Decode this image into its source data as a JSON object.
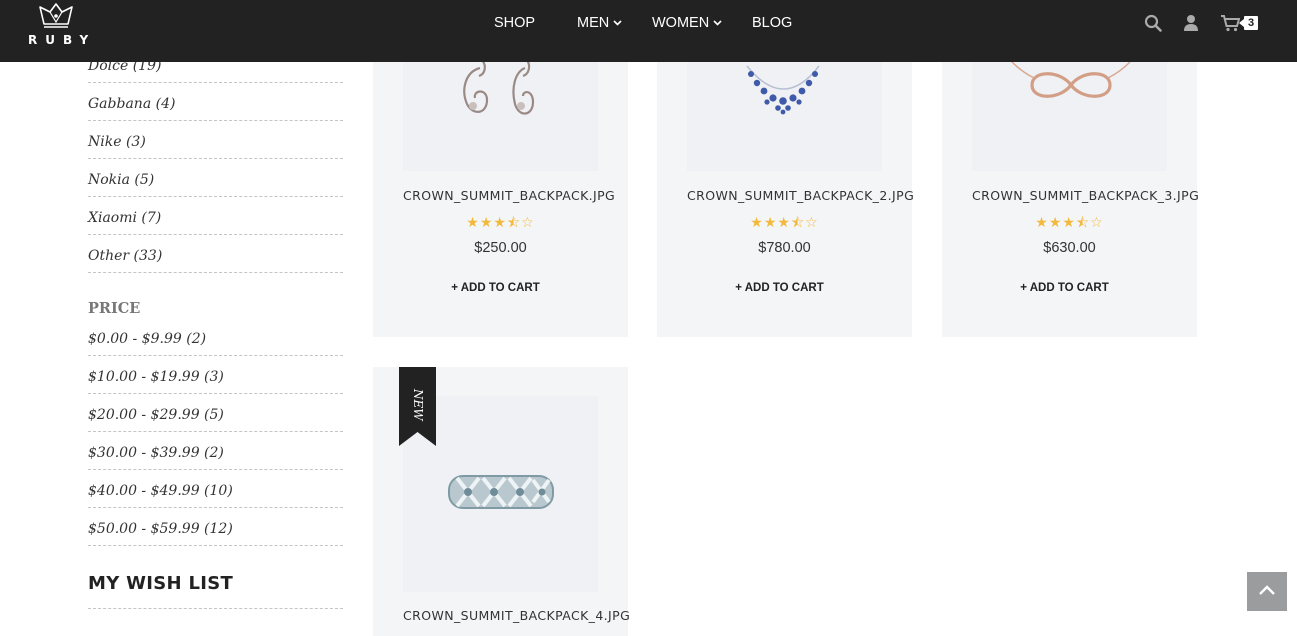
{
  "brand": {
    "name": "RUBY"
  },
  "nav": {
    "items": [
      {
        "label": "SHOP",
        "has_dropdown": false
      },
      {
        "label": "MEN",
        "has_dropdown": true
      },
      {
        "label": "WOMEN",
        "has_dropdown": true
      },
      {
        "label": "BLOG",
        "has_dropdown": false
      }
    ]
  },
  "header_icons": [
    "search-icon",
    "user-icon",
    "cart-icon"
  ],
  "cart": {
    "count": "3"
  },
  "sidebar": {
    "brands": [
      {
        "label": "Dolce (19)"
      },
      {
        "label": "Gabbana (4)"
      },
      {
        "label": "Nike (3)"
      },
      {
        "label": "Nokia (5)"
      },
      {
        "label": "Xiaomi (7)"
      },
      {
        "label": "Other (33)"
      }
    ],
    "price_title": "PRICE",
    "prices": [
      {
        "label": "$0.00 - $9.99 (2)"
      },
      {
        "label": "$10.00 - $19.99 (3)"
      },
      {
        "label": "$20.00 - $29.99 (5)"
      },
      {
        "label": "$30.00 - $39.99 (2)"
      },
      {
        "label": "$40.00 - $49.99 (10)"
      },
      {
        "label": "$50.00 - $59.99 (12)"
      }
    ],
    "wishlist_title": "MY WISH LIST"
  },
  "products": [
    {
      "name": "CROWN_SUMMIT_BACKPACK.JPG",
      "price": "$250.00",
      "rating": 3.5,
      "add_label": "+ ADD TO CART",
      "image": "earrings"
    },
    {
      "name": "CROWN_SUMMIT_BACKPACK_2.JPG",
      "price": "$780.00",
      "rating": 3.5,
      "add_label": "+ ADD TO CART",
      "image": "necklace"
    },
    {
      "name": "CROWN_SUMMIT_BACKPACK_3.JPG",
      "price": "$630.00",
      "rating": 3.5,
      "add_label": "+ ADD TO CART",
      "image": "infinity-necklace"
    },
    {
      "name": "CROWN_SUMMIT_BACKPACK_4.JPG",
      "badge": "NEW",
      "image": "ring"
    }
  ],
  "colors": {
    "header_bg": "#222222",
    "star": "#f2b93c",
    "card_bg": "#f4f5f7"
  }
}
